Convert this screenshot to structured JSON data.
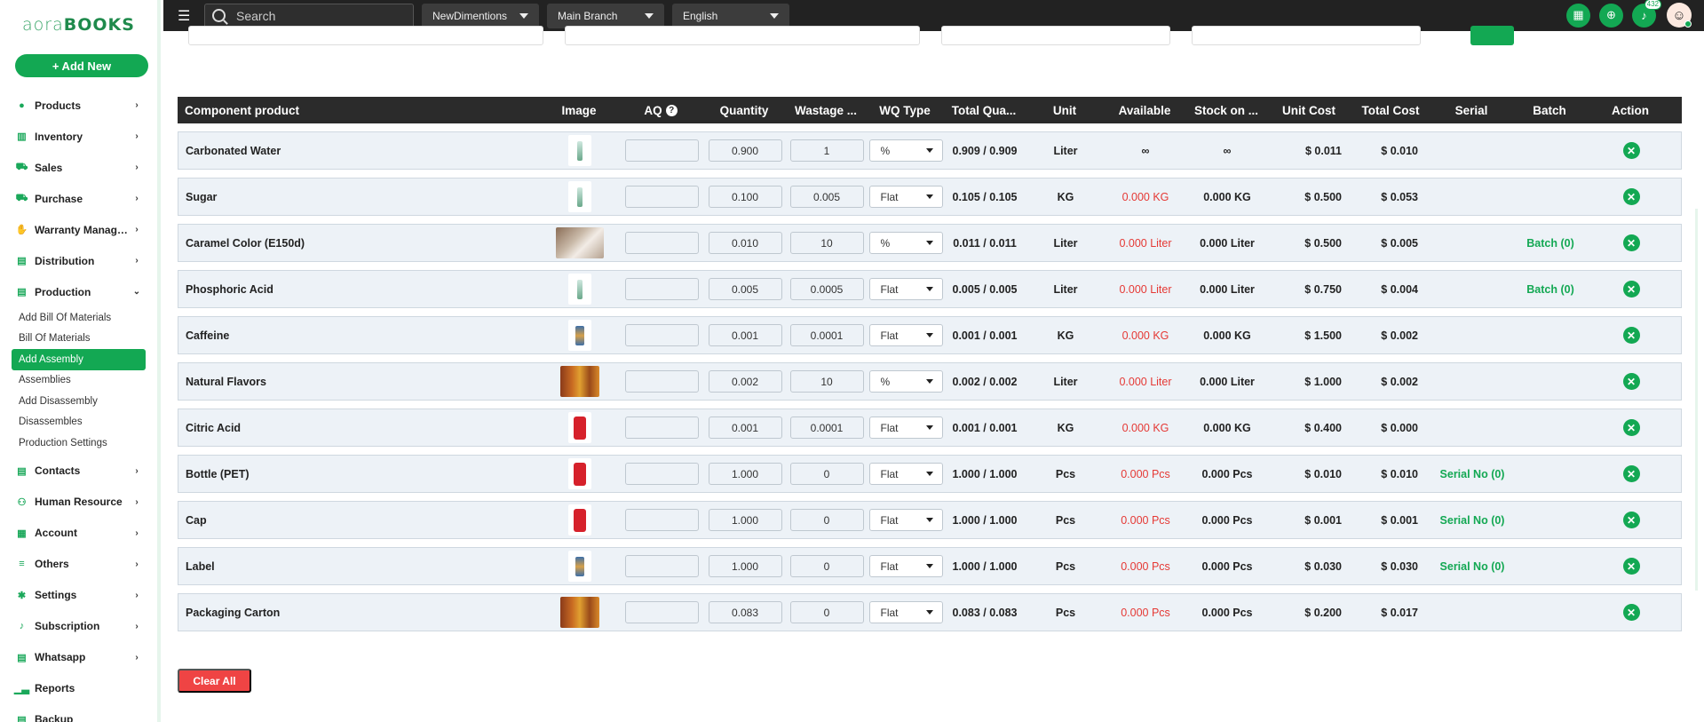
{
  "app": {
    "logo_light": "aora",
    "logo_bold": "BOOKS",
    "add_new": "+ Add New"
  },
  "topbar": {
    "search_placeholder": "Search",
    "business": "NewDimentions",
    "branch": "Main Branch",
    "language": "English",
    "notifications_count": "432"
  },
  "sidebar": {
    "items": [
      {
        "label": "Products",
        "icon": "tag-icon"
      },
      {
        "label": "Inventory",
        "icon": "bank-icon"
      },
      {
        "label": "Sales",
        "icon": "cart-icon"
      },
      {
        "label": "Purchase",
        "icon": "cart-icon"
      },
      {
        "label": "Warranty Manageme...",
        "icon": "thumb-icon"
      },
      {
        "label": "Distribution",
        "icon": "doc-icon"
      },
      {
        "label": "Production",
        "icon": "doc-icon"
      }
    ],
    "production_sub": [
      "Add Bill Of Materials",
      "Bill Of Materials",
      "Add Assembly",
      "Assemblies",
      "Add Disassembly",
      "Disassembles",
      "Production Settings"
    ],
    "items_after": [
      {
        "label": "Contacts",
        "icon": "doc-icon"
      },
      {
        "label": "Human Resource",
        "icon": "users-icon"
      },
      {
        "label": "Account",
        "icon": "calc-icon"
      },
      {
        "label": "Others",
        "icon": "list-icon"
      },
      {
        "label": "Settings",
        "icon": "gear-icon"
      },
      {
        "label": "Subscription",
        "icon": "bell-icon"
      },
      {
        "label": "Whatsapp",
        "icon": "doc-icon"
      },
      {
        "label": "Reports",
        "icon": "chart-icon"
      },
      {
        "label": "Backup",
        "icon": "doc-icon"
      }
    ]
  },
  "table": {
    "headers": [
      "Component product",
      "Image",
      "AQ",
      "Quantity",
      "Wastage ...",
      "WQ Type",
      "Total Qua...",
      "Unit",
      "Available",
      "Stock on ...",
      "Unit Cost",
      "Total Cost",
      "Serial",
      "Batch",
      "Action"
    ],
    "rows": [
      {
        "product": "Carbonated Water",
        "img": "bottle",
        "qty": "0.900",
        "wastage": "1",
        "wq_type": "%",
        "total_qty": "0.909 / 0.909",
        "unit": "Liter",
        "available": "∞",
        "available_red": false,
        "stock": "∞",
        "unit_cost": "$ 0.011",
        "total_cost": "$ 0.010",
        "serial": "",
        "batch": ""
      },
      {
        "product": "Sugar",
        "img": "bottle",
        "qty": "0.100",
        "wastage": "0.005",
        "wq_type": "Flat",
        "total_qty": "0.105 / 0.105",
        "unit": "KG",
        "available": "0.000 KG",
        "available_red": true,
        "stock": "0.000 KG",
        "unit_cost": "$ 0.500",
        "total_cost": "$ 0.053",
        "serial": "",
        "batch": ""
      },
      {
        "product": "Caramel Color (E150d)",
        "img": "sugar",
        "qty": "0.010",
        "wastage": "10",
        "wq_type": "%",
        "total_qty": "0.011 / 0.011",
        "unit": "Liter",
        "available": "0.000 Liter",
        "available_red": true,
        "stock": "0.000 Liter",
        "unit_cost": "$ 0.500",
        "total_cost": "$ 0.005",
        "serial": "",
        "batch": "Batch (0)"
      },
      {
        "product": "Phosphoric Acid",
        "img": "bottle",
        "qty": "0.005",
        "wastage": "0.0005",
        "wq_type": "Flat",
        "total_qty": "0.005 / 0.005",
        "unit": "Liter",
        "available": "0.000 Liter",
        "available_red": true,
        "stock": "0.000 Liter",
        "unit_cost": "$ 0.750",
        "total_cost": "$ 0.004",
        "serial": "",
        "batch": "Batch (0)"
      },
      {
        "product": "Caffeine",
        "img": "can",
        "qty": "0.001",
        "wastage": "0.0001",
        "wq_type": "Flat",
        "total_qty": "0.001 / 0.001",
        "unit": "KG",
        "available": "0.000 KG",
        "available_red": true,
        "stock": "0.000 KG",
        "unit_cost": "$ 1.500",
        "total_cost": "$ 0.002",
        "serial": "",
        "batch": ""
      },
      {
        "product": "Natural Flavors",
        "img": "spice",
        "qty": "0.002",
        "wastage": "10",
        "wq_type": "%",
        "total_qty": "0.002 / 0.002",
        "unit": "Liter",
        "available": "0.000 Liter",
        "available_red": true,
        "stock": "0.000 Liter",
        "unit_cost": "$ 1.000",
        "total_cost": "$ 0.002",
        "serial": "",
        "batch": ""
      },
      {
        "product": "Citric Acid",
        "img": "coke",
        "qty": "0.001",
        "wastage": "0.0001",
        "wq_type": "Flat",
        "total_qty": "0.001 / 0.001",
        "unit": "KG",
        "available": "0.000 KG",
        "available_red": true,
        "stock": "0.000 KG",
        "unit_cost": "$ 0.400",
        "total_cost": "$ 0.000",
        "serial": "",
        "batch": ""
      },
      {
        "product": "Bottle (PET)",
        "img": "coke",
        "qty": "1.000",
        "wastage": "0",
        "wq_type": "Flat",
        "total_qty": "1.000 / 1.000",
        "unit": "Pcs",
        "available": "0.000 Pcs",
        "available_red": true,
        "stock": "0.000 Pcs",
        "unit_cost": "$ 0.010",
        "total_cost": "$ 0.010",
        "serial": "Serial No (0)",
        "batch": ""
      },
      {
        "product": "Cap",
        "img": "coke",
        "qty": "1.000",
        "wastage": "0",
        "wq_type": "Flat",
        "total_qty": "1.000 / 1.000",
        "unit": "Pcs",
        "available": "0.000 Pcs",
        "available_red": true,
        "stock": "0.000 Pcs",
        "unit_cost": "$ 0.001",
        "total_cost": "$ 0.001",
        "serial": "Serial No (0)",
        "batch": ""
      },
      {
        "product": "Label",
        "img": "can",
        "qty": "1.000",
        "wastage": "0",
        "wq_type": "Flat",
        "total_qty": "1.000 / 1.000",
        "unit": "Pcs",
        "available": "0.000 Pcs",
        "available_red": true,
        "stock": "0.000 Pcs",
        "unit_cost": "$ 0.030",
        "total_cost": "$ 0.030",
        "serial": "Serial No (0)",
        "batch": ""
      },
      {
        "product": "Packaging Carton",
        "img": "spice",
        "qty": "0.083",
        "wastage": "0",
        "wq_type": "Flat",
        "total_qty": "0.083 / 0.083",
        "unit": "Pcs",
        "available": "0.000 Pcs",
        "available_red": true,
        "stock": "0.000 Pcs",
        "unit_cost": "$ 0.200",
        "total_cost": "$ 0.017",
        "serial": "",
        "batch": ""
      }
    ]
  },
  "actions": {
    "clear_all": "Clear All"
  }
}
